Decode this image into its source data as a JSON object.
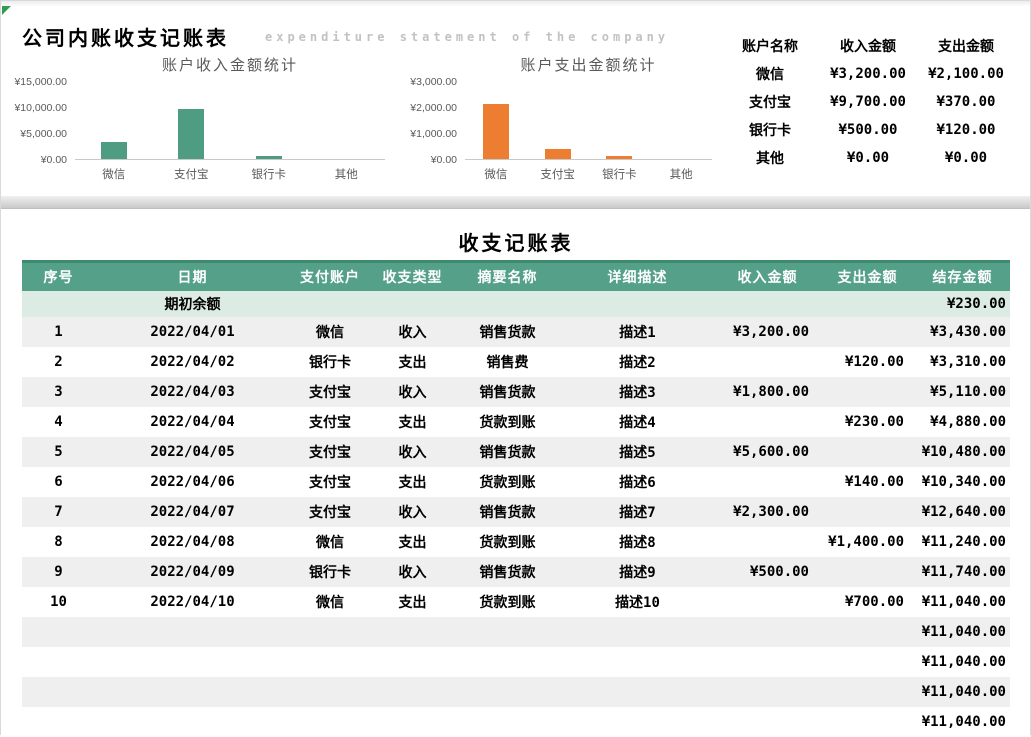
{
  "page": {
    "title": "公司内账收支记账表",
    "subtitle": "expenditure statement of the company"
  },
  "colors": {
    "table_header_green": "#54a089",
    "table_header_border": "#3e8a6e",
    "opening_row_green": "#dcece4",
    "alt_row_gray": "#efefef",
    "income_bar": "#4e9d83",
    "expense_bar": "#ed7d31",
    "subtitle_gray": "#c2c2c2",
    "corner_triangle_green": "#2f9e4f"
  },
  "chart_data": [
    {
      "type": "bar",
      "title": "账户收入金额统计",
      "categories": [
        "微信",
        "支付宝",
        "银行卡",
        "其他"
      ],
      "values": [
        3200,
        9700,
        500,
        0
      ],
      "xlabel": "",
      "ylabel": "",
      "ylim": [
        0,
        15000
      ],
      "yticks": [
        "¥15,000.00",
        "¥10,000.00",
        "¥5,000.00",
        "¥0.00"
      ],
      "grid": false,
      "legend": "none",
      "bar_color": "#4e9d83"
    },
    {
      "type": "bar",
      "title": "账户支出金额统计",
      "categories": [
        "微信",
        "支付宝",
        "银行卡",
        "其他"
      ],
      "values": [
        2100,
        370,
        120,
        0
      ],
      "xlabel": "",
      "ylabel": "",
      "ylim": [
        0,
        3000
      ],
      "yticks": [
        "¥3,000.00",
        "¥2,000.00",
        "¥1,000.00",
        "¥0.00"
      ],
      "grid": false,
      "legend": "none",
      "bar_color": "#ed7d31"
    }
  ],
  "summary": {
    "headers": [
      "账户名称",
      "收入金额",
      "支出金额"
    ],
    "rows": [
      [
        "微信",
        "¥3,200.00",
        "¥2,100.00"
      ],
      [
        "支付宝",
        "¥9,700.00",
        "¥370.00"
      ],
      [
        "银行卡",
        "¥500.00",
        "¥120.00"
      ],
      [
        "其他",
        "¥0.00",
        "¥0.00"
      ]
    ]
  },
  "ledger": {
    "title": "收支记账表",
    "headers": [
      "序号",
      "日期",
      "支付账户",
      "收支类型",
      "摘要名称",
      "详细描述",
      "收入金额",
      "支出金额",
      "结存金额"
    ],
    "opening_row": {
      "label": "期初余额",
      "balance": "¥230.00"
    },
    "rows": [
      [
        "1",
        "2022/04/01",
        "微信",
        "收入",
        "销售货款",
        "描述1",
        "¥3,200.00",
        "",
        "¥3,430.00"
      ],
      [
        "2",
        "2022/04/02",
        "银行卡",
        "支出",
        "销售费",
        "描述2",
        "",
        "¥120.00",
        "¥3,310.00"
      ],
      [
        "3",
        "2022/04/03",
        "支付宝",
        "收入",
        "销售货款",
        "描述3",
        "¥1,800.00",
        "",
        "¥5,110.00"
      ],
      [
        "4",
        "2022/04/04",
        "支付宝",
        "支出",
        "货款到账",
        "描述4",
        "",
        "¥230.00",
        "¥4,880.00"
      ],
      [
        "5",
        "2022/04/05",
        "支付宝",
        "收入",
        "销售货款",
        "描述5",
        "¥5,600.00",
        "",
        "¥10,480.00"
      ],
      [
        "6",
        "2022/04/06",
        "支付宝",
        "支出",
        "货款到账",
        "描述6",
        "",
        "¥140.00",
        "¥10,340.00"
      ],
      [
        "7",
        "2022/04/07",
        "支付宝",
        "收入",
        "销售货款",
        "描述7",
        "¥2,300.00",
        "",
        "¥12,640.00"
      ],
      [
        "8",
        "2022/04/08",
        "微信",
        "支出",
        "货款到账",
        "描述8",
        "",
        "¥1,400.00",
        "¥11,240.00"
      ],
      [
        "9",
        "2022/04/09",
        "银行卡",
        "收入",
        "销售货款",
        "描述9",
        "¥500.00",
        "",
        "¥11,740.00"
      ],
      [
        "10",
        "2022/04/10",
        "微信",
        "支出",
        "货款到账",
        "描述10",
        "",
        "¥700.00",
        "¥11,040.00"
      ]
    ],
    "empty_rows": [
      {
        "balance": "¥11,040.00"
      },
      {
        "balance": "¥11,040.00"
      },
      {
        "balance": "¥11,040.00"
      },
      {
        "balance": "¥11,040.00"
      }
    ]
  }
}
